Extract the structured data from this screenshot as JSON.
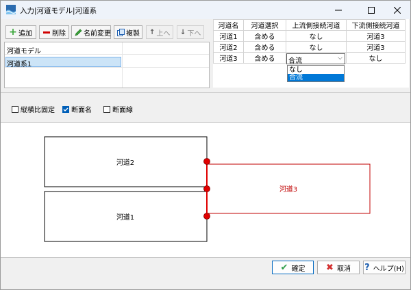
{
  "window": {
    "title": "入力|河道モデル|河道系"
  },
  "toolbar": {
    "add": "追加",
    "delete": "削除",
    "rename": "名前変更",
    "duplicate": "複製",
    "up": "上へ",
    "down": "下へ"
  },
  "model_list": {
    "items": [
      "河道モデル",
      "河道系1"
    ]
  },
  "river_table": {
    "headers": [
      "河道名",
      "河道選択",
      "上流側接続河道",
      "下流側接続河道"
    ],
    "rows": [
      [
        "河道1",
        "含める",
        "なし",
        "河道3"
      ],
      [
        "河道2",
        "含める",
        "なし",
        "河道3"
      ],
      [
        "河道3",
        "含める",
        "合流",
        "なし"
      ]
    ],
    "dropdown_options": [
      "なし",
      "合流"
    ]
  },
  "options": {
    "fix_aspect": "縦横比固定",
    "section_name": "断面名",
    "section_line": "断面線"
  },
  "diagram": {
    "labels": [
      "河道2",
      "河道1",
      "河道3"
    ]
  },
  "buttons": {
    "ok": "確定",
    "cancel": "取消",
    "help": "ヘルプ(H)"
  },
  "colors": {
    "accent": "#0078d7",
    "node": "#e00000",
    "river3": "#c00000"
  }
}
